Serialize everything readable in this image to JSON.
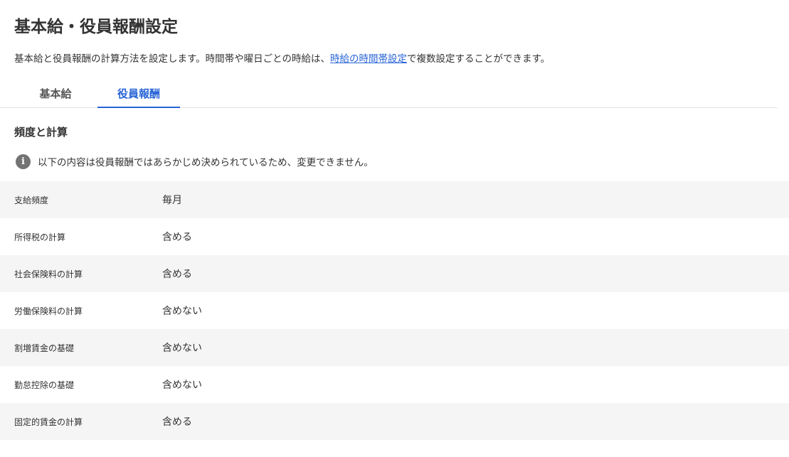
{
  "header": {
    "title": "基本給・役員報酬設定",
    "description_before": "基本給と役員報酬の計算方法を設定します。時間帯や曜日ごとの時給は、",
    "description_link": "時給の時間帯設定",
    "description_after": "で複数設定することができます。"
  },
  "tabs": [
    {
      "label": "基本給",
      "active": false
    },
    {
      "label": "役員報酬",
      "active": true
    }
  ],
  "section": {
    "title": "頻度と計算",
    "info_icon": "info-icon",
    "info_symbol": "i",
    "info_text": "以下の内容は役員報酬ではあらかじめ決められているため、変更できません。"
  },
  "rows": [
    {
      "label": "支給頻度",
      "value": "毎月"
    },
    {
      "label": "所得税の計算",
      "value": "含める"
    },
    {
      "label": "社会保険料の計算",
      "value": "含める"
    },
    {
      "label": "労働保険料の計算",
      "value": "含めない"
    },
    {
      "label": "割増賃金の基礎",
      "value": "含めない"
    },
    {
      "label": "勤怠控除の基礎",
      "value": "含めない"
    },
    {
      "label": "固定的賃金の計算",
      "value": "含める"
    }
  ],
  "colors": {
    "accent": "#2864d6",
    "row_stripe": "#f6f5f5",
    "text": "#333333"
  }
}
